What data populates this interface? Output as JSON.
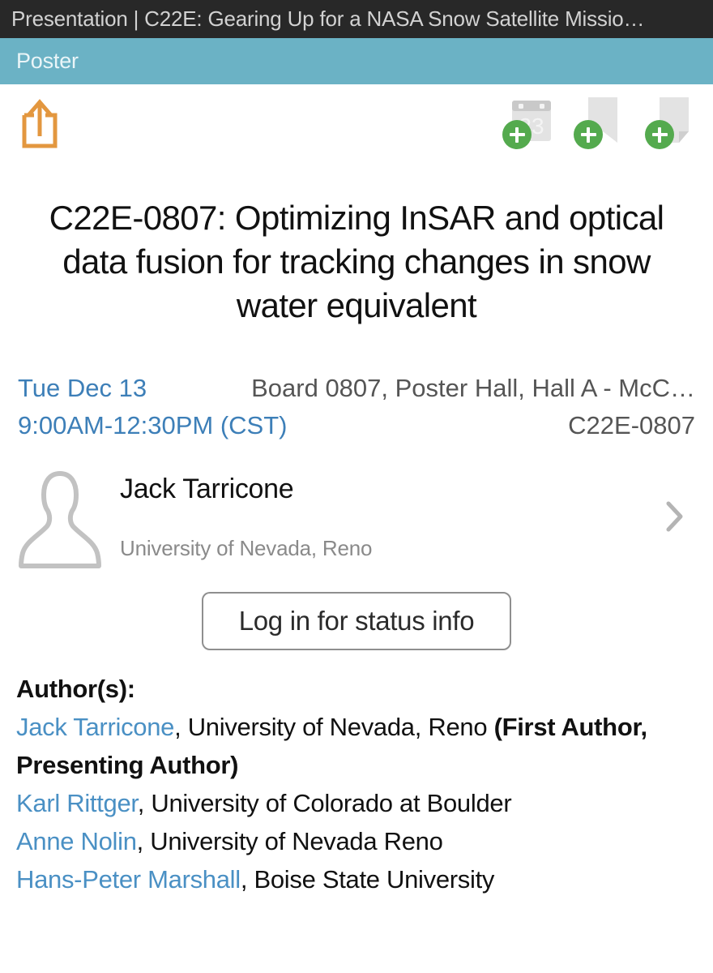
{
  "titlebar": {
    "text": "Presentation | C22E: Gearing Up for a NASA Snow Satellite Missio…"
  },
  "sectionbar": {
    "label": "Poster"
  },
  "actions": {
    "share_label": "share-icon",
    "add_to_calendar_label": "add-to-calendar-icon",
    "calendar_day": "23",
    "add_bookmark_label": "add-bookmark-icon",
    "add_note_label": "add-note-icon"
  },
  "presentation": {
    "title": "C22E-0807: Optimizing InSAR and optical data fusion for tracking changes in snow water equivalent",
    "date": "Tue Dec 13",
    "time": "9:00AM-12:30PM (CST)",
    "location": "Board 0807, Poster Hall, Hall A - McC…",
    "code": "C22E-0807"
  },
  "presenter": {
    "name": "Jack Tarricone",
    "organization": "University of Nevada, Reno"
  },
  "login": {
    "label": "Log in for status info"
  },
  "authors": {
    "heading": "Author(s):",
    "list": [
      {
        "name": "Jack Tarricone",
        "affiliation": ", University of Nevada, Reno ",
        "note": "(First Author, Presenting Author)"
      },
      {
        "name": "Karl Rittger",
        "affiliation": ", University of Colorado at Boulder",
        "note": ""
      },
      {
        "name": "Anne Nolin",
        "affiliation": ", University of Nevada Reno",
        "note": ""
      },
      {
        "name": "Hans-Peter Marshall",
        "affiliation": ", Boise State University",
        "note": ""
      }
    ]
  },
  "colors": {
    "titlebar_bg": "#282828",
    "section_bg": "#6bb2c5",
    "share_orange": "#e3973f",
    "badge_green": "#54aa4e",
    "link_blue": "#4a90c4",
    "date_blue": "#3d7fb8",
    "icon_gray": "#e3e3e3"
  }
}
